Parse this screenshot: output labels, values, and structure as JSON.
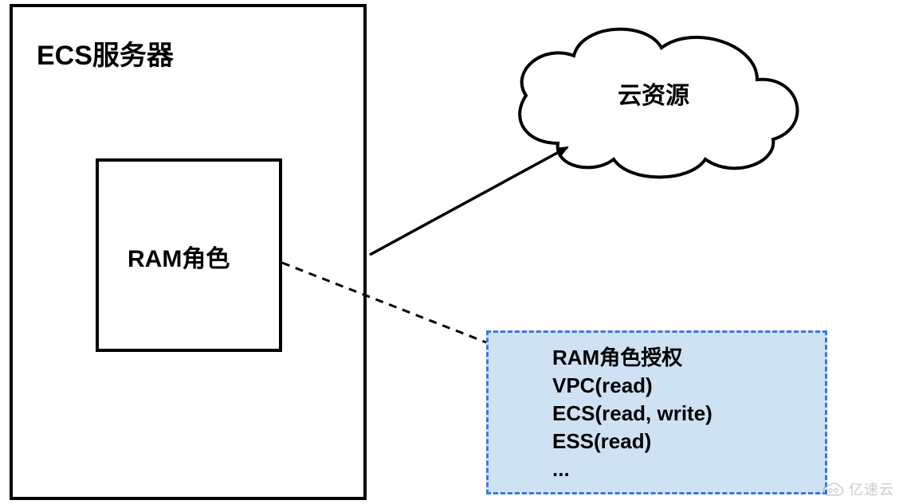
{
  "ecs_server": {
    "title": "ECS服务器",
    "ram_role": {
      "label": "RAM角色"
    }
  },
  "cloud": {
    "label": "云资源"
  },
  "authorization": {
    "title": "RAM角色授权",
    "entries": [
      "VPC(read)",
      "ECS(read, write)",
      "ESS(read)",
      "..."
    ]
  },
  "watermark": {
    "text": "亿速云"
  }
}
